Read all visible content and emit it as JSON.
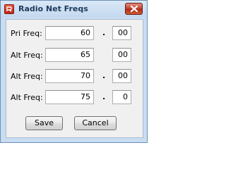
{
  "window": {
    "title": "Radio Net Freqs",
    "icon": "app-icon",
    "close_icon": "close-icon"
  },
  "rows": [
    {
      "label": "Pri Freq:",
      "whole": "60",
      "separator": ".",
      "fraction": "00"
    },
    {
      "label": "Alt Freq:",
      "whole": "65",
      "separator": ".",
      "fraction": "00"
    },
    {
      "label": "Alt Freq:",
      "whole": "70",
      "separator": ".",
      "fraction": "00"
    },
    {
      "label": "Alt Freq:",
      "whole": "75",
      "separator": ".",
      "fraction": "0"
    }
  ],
  "buttons": {
    "save_label": "Save",
    "cancel_label": "Cancel"
  },
  "colors": {
    "frame": "#c9ddf2",
    "close_button": "#c6432e",
    "client": "#f0f0f0"
  }
}
